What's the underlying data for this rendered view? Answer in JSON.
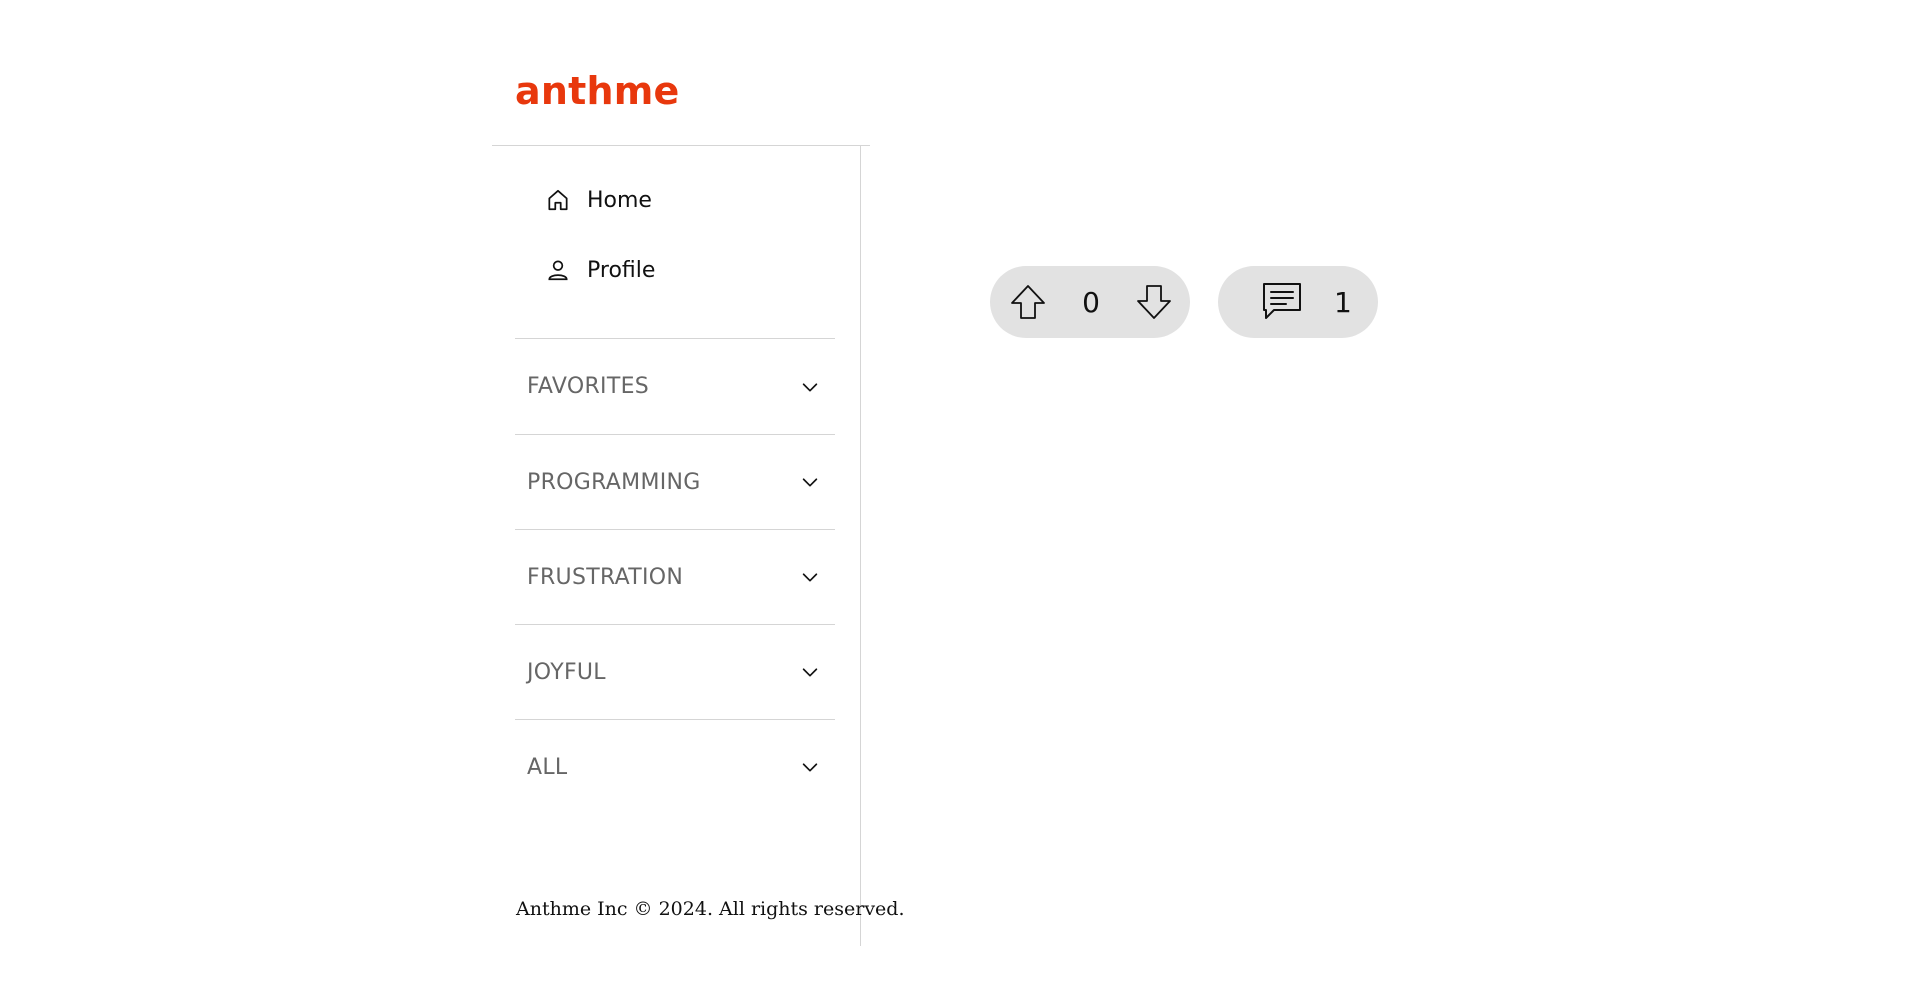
{
  "brand": {
    "name": "anthme",
    "color": "#e8380d"
  },
  "nav": [
    {
      "label": "Home",
      "icon": "home-icon"
    },
    {
      "label": "Profile",
      "icon": "user-icon"
    }
  ],
  "categories": [
    {
      "label": "FAVORITES"
    },
    {
      "label": "PROGRAMMING"
    },
    {
      "label": "FRUSTRATION"
    },
    {
      "label": "JOYFUL"
    },
    {
      "label": "ALL"
    }
  ],
  "footer": {
    "text": "Anthme Inc © 2024. All rights reserved."
  },
  "post": {
    "vote_count": "0",
    "comment_count": "1"
  }
}
